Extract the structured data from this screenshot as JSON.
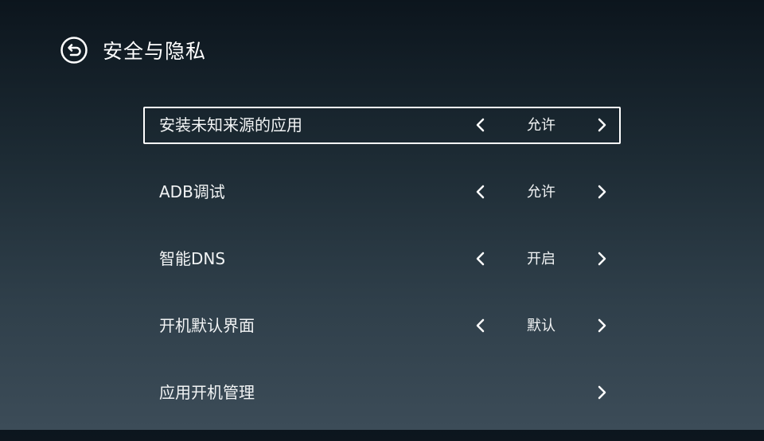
{
  "header": {
    "title": "安全与隐私",
    "back_icon": "back-arrow-circle-icon"
  },
  "settings": [
    {
      "label": "安装未知来源的应用",
      "value": "允许",
      "focused": true
    },
    {
      "label": "ADB调试",
      "value": "允许",
      "focused": false
    },
    {
      "label": "智能DNS",
      "value": "开启",
      "focused": false
    },
    {
      "label": "开机默认界面",
      "value": "默认",
      "focused": false
    },
    {
      "label": "应用开机管理",
      "value": "",
      "focused": false
    }
  ],
  "colors": {
    "text": "#ffffff",
    "focus_border": "#ffffff",
    "background_top": "#0c151d",
    "background_bottom": "#3c4c58"
  }
}
